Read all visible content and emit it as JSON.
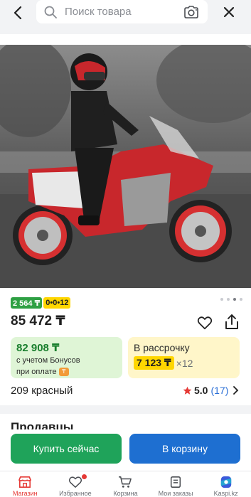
{
  "header": {
    "search_placeholder": "Поиск товара"
  },
  "product": {
    "badge_bonus": "2 564 ₸",
    "badge_installment": "0•0•12",
    "price": "85 472 ₸",
    "bonus_card": {
      "price": "82 908 ₸",
      "line1": "с учетом Бонусов",
      "line2": "при оплате"
    },
    "credit_card": {
      "title": "В рассрочку",
      "amount": "7 123 ₸",
      "multiplier": "×12"
    },
    "variant": "209 красный",
    "rating": "5.0",
    "reviews": "(17)"
  },
  "sellers_heading": "Продавцы",
  "actions": {
    "buy_label": "Купить сейчас",
    "cart_label": "В корзину"
  },
  "nav": {
    "items": [
      {
        "label": "Магазин",
        "icon": "shop-icon"
      },
      {
        "label": "Избранное",
        "icon": "heart-icon"
      },
      {
        "label": "Корзина",
        "icon": "cart-icon"
      },
      {
        "label": "Мои заказы",
        "icon": "orders-icon"
      },
      {
        "label": "Kaspi.kz",
        "icon": "kaspi-logo-icon"
      }
    ]
  },
  "colors": {
    "accent_green": "#1fa35a",
    "accent_blue": "#1e6fd1",
    "bonus_bg": "#dff5d6",
    "credit_bg": "#fff6c9",
    "yellow": "#ffd600",
    "brand_red": "#e53935"
  }
}
